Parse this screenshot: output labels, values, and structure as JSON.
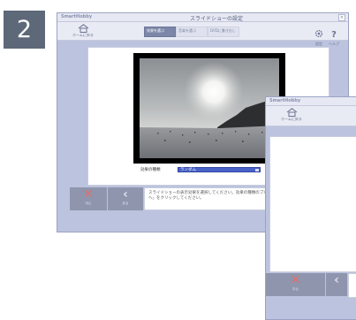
{
  "step_number": "2",
  "main_window": {
    "brand": "SmartHobby",
    "title": "スライドショーの設定",
    "close": "×",
    "home_label": "ホームに戻る",
    "steps": [
      "効果を選ぶ",
      "音楽を選ぶ",
      "DVDに書き出し"
    ],
    "settings_label": "設定",
    "help_label": "ヘルプ",
    "effect_label": "効果の種類",
    "effect_value": "ランダム",
    "cancel_label": "中止",
    "back_label": "戻る",
    "instruction": "スライドショーの表示効果を選択してください。効果の種類のプルダウンメニューから効果を選び、「次へ」をクリックしてください。"
  },
  "second_window": {
    "brand": "SmartHobby",
    "home_label": "ホームに戻る",
    "cancel_label": "中止"
  },
  "colors": {
    "window_bg": "#bcc3de",
    "button_bg": "#8e95ad",
    "cancel_x": "#e07070",
    "select_bg": "#4a63c8"
  }
}
